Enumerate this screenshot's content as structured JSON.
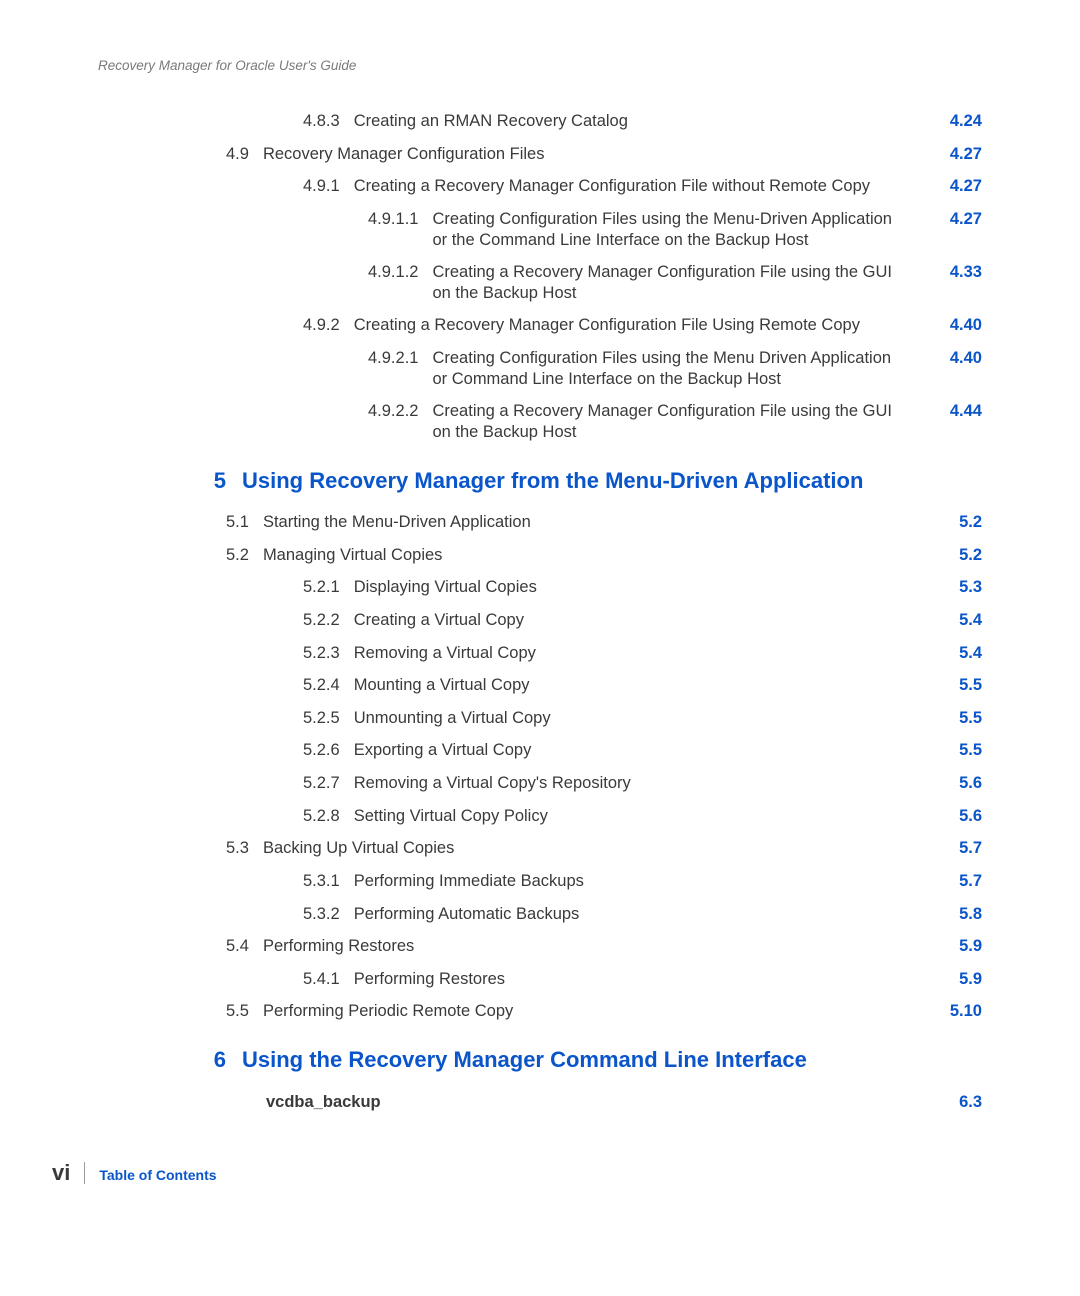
{
  "running_header": "Recovery Manager for Oracle User's Guide",
  "footer": {
    "page_number": "vi",
    "label": "Table of Contents"
  },
  "entries": [
    {
      "kind": "s2",
      "num": "4.8.3",
      "label": "Creating an RMAN Recovery Catalog",
      "page": "4.24"
    },
    {
      "kind": "s1",
      "num": "4.9",
      "label": "Recovery Manager Configuration Files",
      "page": "4.27"
    },
    {
      "kind": "s2",
      "num": "4.9.1",
      "label": "Creating a Recovery Manager Configuration File without Remote Copy",
      "page": "4.27"
    },
    {
      "kind": "s3",
      "num": "4.9.1.1",
      "label": "Creating Configuration Files using the Menu-Driven Application or the Command Line Interface on the Backup Host",
      "page": "4.27"
    },
    {
      "kind": "s3",
      "num": "4.9.1.2",
      "label": "Creating a Recovery Manager Configuration File using the GUI on the Backup Host",
      "page": "4.33"
    },
    {
      "kind": "s2",
      "num": "4.9.2",
      "label": "Creating a Recovery Manager Configuration File Using Remote Copy",
      "page": "4.40"
    },
    {
      "kind": "s3",
      "num": "4.9.2.1",
      "label": "Creating Configuration Files using the Menu Driven Application or Command Line Interface on the Backup Host",
      "page": "4.40"
    },
    {
      "kind": "s3",
      "num": "4.9.2.2",
      "label": "Creating a Recovery Manager Configuration File using the GUI on the Backup Host",
      "page": "4.44"
    },
    {
      "kind": "chapter",
      "num": "5",
      "label": "Using Recovery Manager from the Menu-Driven Application"
    },
    {
      "kind": "s1",
      "num": "5.1",
      "label": "Starting the Menu-Driven Application",
      "page": "5.2"
    },
    {
      "kind": "s1",
      "num": "5.2",
      "label": "Managing Virtual Copies",
      "page": "5.2"
    },
    {
      "kind": "s2",
      "num": "5.2.1",
      "label": "Displaying Virtual Copies",
      "page": "5.3"
    },
    {
      "kind": "s2",
      "num": "5.2.2",
      "label": "Creating a Virtual Copy",
      "page": "5.4"
    },
    {
      "kind": "s2",
      "num": "5.2.3",
      "label": "Removing a Virtual Copy",
      "page": "5.4"
    },
    {
      "kind": "s2",
      "num": "5.2.4",
      "label": "Mounting a Virtual Copy",
      "page": "5.5"
    },
    {
      "kind": "s2",
      "num": "5.2.5",
      "label": "Unmounting a Virtual Copy",
      "page": "5.5"
    },
    {
      "kind": "s2",
      "num": "5.2.6",
      "label": "Exporting a Virtual Copy",
      "page": "5.5"
    },
    {
      "kind": "s2",
      "num": "5.2.7",
      "label": "Removing a Virtual Copy's Repository",
      "page": "5.6"
    },
    {
      "kind": "s2",
      "num": "5.2.8",
      "label": "Setting Virtual Copy Policy",
      "page": "5.6"
    },
    {
      "kind": "s1",
      "num": "5.3",
      "label": "Backing Up Virtual Copies",
      "page": "5.7"
    },
    {
      "kind": "s2",
      "num": "5.3.1",
      "label": "Performing Immediate Backups",
      "page": "5.7"
    },
    {
      "kind": "s2",
      "num": "5.3.2",
      "label": "Performing Automatic Backups",
      "page": "5.8"
    },
    {
      "kind": "s1",
      "num": "5.4",
      "label": "Performing Restores",
      "page": "5.9"
    },
    {
      "kind": "s2",
      "num": "5.4.1",
      "label": "Performing Restores",
      "page": "5.9"
    },
    {
      "kind": "s1",
      "num": "5.5",
      "label": "Performing Periodic Remote Copy",
      "page": "5.10"
    },
    {
      "kind": "chapter",
      "num": "6",
      "label": "Using the Recovery Manager Command Line Interface"
    },
    {
      "kind": "cmd",
      "label": "vcdba_backup",
      "page": "6.3"
    }
  ]
}
